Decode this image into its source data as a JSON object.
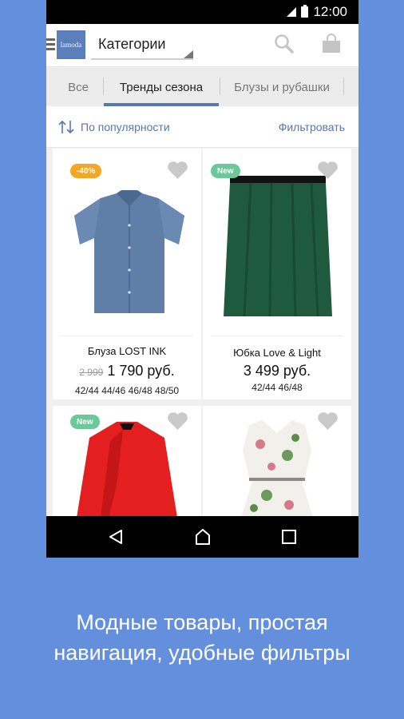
{
  "status": {
    "time": "12:00"
  },
  "appbar": {
    "logo_text": "lamoda",
    "category_label": "Категории"
  },
  "tabs": [
    {
      "label": "Все"
    },
    {
      "label": "Тренды сезона"
    },
    {
      "label": "Блузы и рубашки"
    }
  ],
  "sortbar": {
    "sort_label": "По популярности",
    "filter_label": "Фильтровать"
  },
  "products": [
    {
      "badge": "-40%",
      "badge_color": "#f5a623",
      "name": "Блуза LOST INK",
      "old_price": "2 999",
      "price": "1 790 руб.",
      "sizes": "42/44 44/46 46/48 48/50"
    },
    {
      "badge": "New",
      "badge_color": "#6cc79a",
      "name": "Юбка Love & Light",
      "old_price": "",
      "price": "3 499 руб.",
      "sizes": "42/44 46/48"
    },
    {
      "badge": "New",
      "badge_color": "#6cc79a"
    },
    {}
  ],
  "caption": {
    "line1": "Модные товары, простая",
    "line2": "навигация, удобные фильтры"
  },
  "colors": {
    "accent": "#5577b4",
    "background": "#648fdc"
  }
}
